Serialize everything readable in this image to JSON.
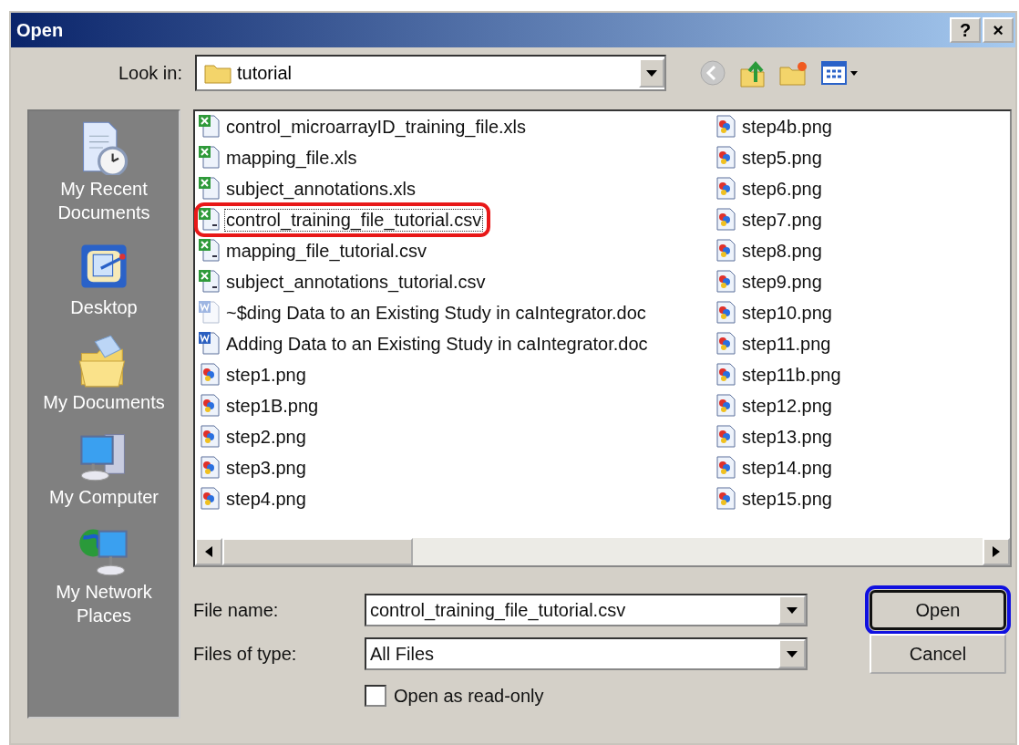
{
  "window": {
    "title": "Open",
    "help_button": "?",
    "close_button": "×"
  },
  "look_in": {
    "label": "Look in:",
    "value": "tutorial"
  },
  "places": [
    {
      "label": "My Recent Documents",
      "kind": "recent"
    },
    {
      "label": "Desktop",
      "kind": "desktop"
    },
    {
      "label": "My Documents",
      "kind": "documents"
    },
    {
      "label": "My Computer",
      "kind": "computer"
    },
    {
      "label": "My Network Places",
      "kind": "network"
    }
  ],
  "files": [
    {
      "name": "control_microarrayID_training_file.xls",
      "kind": "excel",
      "selected": false,
      "dimmed": false,
      "annotated": false
    },
    {
      "name": "mapping_file.xls",
      "kind": "excel",
      "selected": false,
      "dimmed": false,
      "annotated": false
    },
    {
      "name": "subject_annotations.xls",
      "kind": "excel",
      "selected": false,
      "dimmed": false,
      "annotated": false
    },
    {
      "name": "control_training_file_tutorial.csv",
      "kind": "csv",
      "selected": true,
      "dimmed": false,
      "annotated": true
    },
    {
      "name": "mapping_file_tutorial.csv",
      "kind": "csv",
      "selected": false,
      "dimmed": false,
      "annotated": false
    },
    {
      "name": "subject_annotations_tutorial.csv",
      "kind": "csv",
      "selected": false,
      "dimmed": false,
      "annotated": false
    },
    {
      "name": "~$ding Data to an Existing Study in caIntegrator.doc",
      "kind": "word",
      "selected": false,
      "dimmed": true,
      "annotated": false
    },
    {
      "name": "Adding Data to an Existing Study in caIntegrator.doc",
      "kind": "word",
      "selected": false,
      "dimmed": false,
      "annotated": false
    },
    {
      "name": "step1.png",
      "kind": "image",
      "selected": false,
      "dimmed": false,
      "annotated": false
    },
    {
      "name": "step1B.png",
      "kind": "image",
      "selected": false,
      "dimmed": false,
      "annotated": false
    },
    {
      "name": "step2.png",
      "kind": "image",
      "selected": false,
      "dimmed": false,
      "annotated": false
    },
    {
      "name": "step3.png",
      "kind": "image",
      "selected": false,
      "dimmed": false,
      "annotated": false
    },
    {
      "name": "step4.png",
      "kind": "image",
      "selected": false,
      "dimmed": false,
      "annotated": false
    },
    {
      "name": "step4b.png",
      "kind": "image",
      "selected": false,
      "dimmed": false,
      "annotated": false
    },
    {
      "name": "step5.png",
      "kind": "image",
      "selected": false,
      "dimmed": false,
      "annotated": false
    },
    {
      "name": "step6.png",
      "kind": "image",
      "selected": false,
      "dimmed": false,
      "annotated": false
    },
    {
      "name": "step7.png",
      "kind": "image",
      "selected": false,
      "dimmed": false,
      "annotated": false
    },
    {
      "name": "step8.png",
      "kind": "image",
      "selected": false,
      "dimmed": false,
      "annotated": false
    },
    {
      "name": "step9.png",
      "kind": "image",
      "selected": false,
      "dimmed": false,
      "annotated": false
    },
    {
      "name": "step10.png",
      "kind": "image",
      "selected": false,
      "dimmed": false,
      "annotated": false
    },
    {
      "name": "step11.png",
      "kind": "image",
      "selected": false,
      "dimmed": false,
      "annotated": false
    },
    {
      "name": "step11b.png",
      "kind": "image",
      "selected": false,
      "dimmed": false,
      "annotated": false
    },
    {
      "name": "step12.png",
      "kind": "image",
      "selected": false,
      "dimmed": false,
      "annotated": false
    },
    {
      "name": "step13.png",
      "kind": "image",
      "selected": false,
      "dimmed": false,
      "annotated": false
    },
    {
      "name": "step14.png",
      "kind": "image",
      "selected": false,
      "dimmed": false,
      "annotated": false
    },
    {
      "name": "step15.png",
      "kind": "image",
      "selected": false,
      "dimmed": false,
      "annotated": false
    }
  ],
  "file_name": {
    "label": "File name:",
    "value": "control_training_file_tutorial.csv"
  },
  "file_type": {
    "label": "Files of type:",
    "value": "All Files"
  },
  "read_only": {
    "label": "Open as read-only",
    "checked": false
  },
  "buttons": [
    {
      "label": "Open",
      "default": true,
      "annotated": true
    },
    {
      "label": "Cancel",
      "default": false,
      "annotated": false
    }
  ]
}
